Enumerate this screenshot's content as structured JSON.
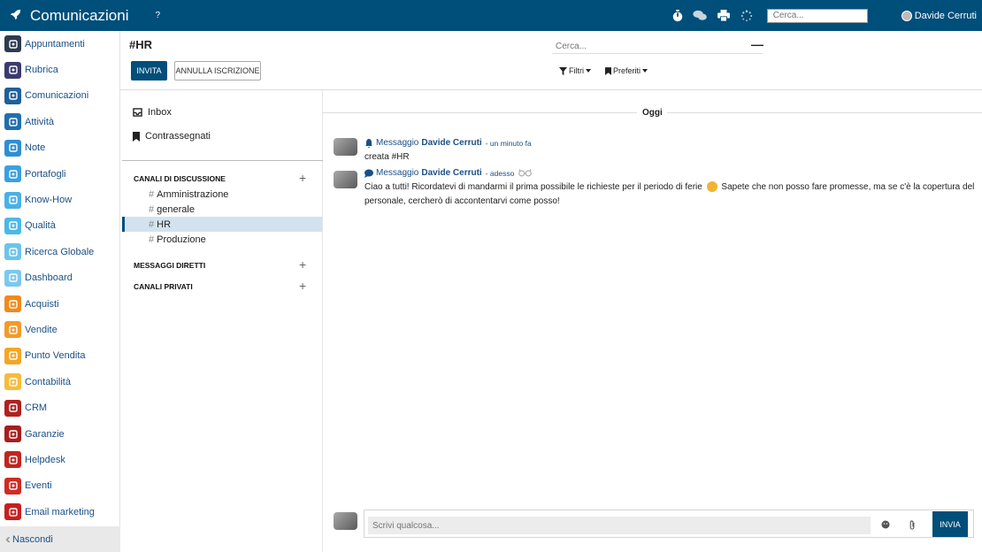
{
  "topbar": {
    "title": "Comunicazioni",
    "help": "?",
    "search_placeholder": "Cerca...",
    "user_name": "Davide Cerruti"
  },
  "sidebar": {
    "items": [
      {
        "label": "Appuntamenti",
        "color": "#2e3b4e",
        "icon": "calendar-icon"
      },
      {
        "label": "Rubrica",
        "color": "#3c3a6e",
        "icon": "contacts-icon"
      },
      {
        "label": "Comunicazioni",
        "color": "#1f5f9c",
        "icon": "chat-icon"
      },
      {
        "label": "Attività",
        "color": "#1f6fae",
        "icon": "checkbox-icon"
      },
      {
        "label": "Note",
        "color": "#2d8fd4",
        "icon": "note-icon"
      },
      {
        "label": "Portafogli",
        "color": "#3aa0e0",
        "icon": "lock-icon"
      },
      {
        "label": "Know-How",
        "color": "#4ab0e6",
        "icon": "brain-icon"
      },
      {
        "label": "Qualità",
        "color": "#4cb8e6",
        "icon": "quality-icon"
      },
      {
        "label": "Ricerca Globale",
        "color": "#6cc4ea",
        "icon": "search-icon"
      },
      {
        "label": "Dashboard",
        "color": "#7bc8ee",
        "icon": "dashboard-icon"
      },
      {
        "label": "Acquisti",
        "color": "#f08a1c",
        "icon": "purchase-icon"
      },
      {
        "label": "Vendite",
        "color": "#f39a2a",
        "icon": "sales-icon"
      },
      {
        "label": "Punto Vendita",
        "color": "#f5a623",
        "icon": "pos-icon"
      },
      {
        "label": "Contabilità",
        "color": "#f7bc3a",
        "icon": "accounting-icon"
      },
      {
        "label": "CRM",
        "color": "#b0221f",
        "icon": "handshake-icon"
      },
      {
        "label": "Garanzie",
        "color": "#a61e1e",
        "icon": "shield-icon"
      },
      {
        "label": "Helpdesk",
        "color": "#c0261f",
        "icon": "headset-icon"
      },
      {
        "label": "Eventi",
        "color": "#d12a23",
        "icon": "ticket-icon"
      },
      {
        "label": "Email marketing",
        "color": "#c71f1f",
        "icon": "send-icon"
      }
    ],
    "hide_label": "Nascondi"
  },
  "header": {
    "title": "#HR",
    "invite_label": "INVITA",
    "unsubscribe_label": "ANNULLA ISCRIZIONE",
    "search_placeholder": "Cerca...",
    "filters_label": "Filtri",
    "favorites_label": "Preferiti"
  },
  "channels": {
    "inbox_label": "Inbox",
    "starred_label": "Contrassegnati",
    "section_channels": "CANALI DI DISCUSSIONE",
    "channel_list": [
      "Amministrazione",
      "generale",
      "HR",
      "Produzione"
    ],
    "active_channel": "HR",
    "section_direct": "MESSAGGI DIRETTI",
    "section_private": "CANALI PRIVATI"
  },
  "messages": {
    "day_label": "Oggi",
    "items": [
      {
        "type": "Messaggio",
        "author": "Davide Cerruti",
        "time": "- un minuto fa",
        "text": "creata #HR"
      },
      {
        "type": "Messaggio",
        "author": "Davide Cerruti",
        "time": "- adesso",
        "text_before_emoji": "Ciao a tutti! Ricordatevi di mandarmi il prima possibile le richieste per il periodo di ferie",
        "text_after_emoji": "Sapete che non posso fare promesse, ma se c'è la copertura del personale, cercherò di accontentarvi come posso!"
      }
    ]
  },
  "composer": {
    "placeholder": "Scrivi qualcosa...",
    "send_label": "INVIA"
  }
}
